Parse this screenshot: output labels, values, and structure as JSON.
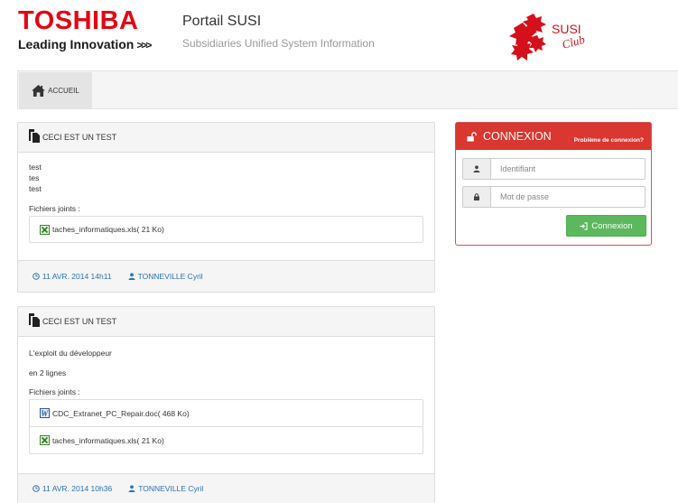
{
  "header": {
    "brand": "TOSHIBA",
    "tagline": "Leading Innovation",
    "tagline_arrows": ">>>",
    "portal_title": "Portail SUSI",
    "portal_subtitle": "Subsidiaries Unified System Information",
    "club_logo_text_1": "SUSI",
    "club_logo_text_2": "Club"
  },
  "nav": {
    "items": [
      {
        "label": "ACCUEIL",
        "icon": "home-icon"
      }
    ]
  },
  "posts": [
    {
      "title": "CECI EST UN TEST",
      "lines": [
        "test",
        "tes",
        "test"
      ],
      "files_label": "Fichiers joints :",
      "files": [
        {
          "name": "taches_informatiques.xls( 21 Ko)",
          "icon": "excel-file-icon"
        }
      ],
      "date": "11 AVR. 2014 14h11",
      "author": "TONNEVILLE Cyril"
    },
    {
      "title": "CECI EST UN TEST",
      "lines": [
        "L'exploit du développeur",
        "en 2 lignes"
      ],
      "files_label": "Fichiers joints :",
      "files": [
        {
          "name": "CDC_Extranet_PC_Repair.doc( 468 Ko)",
          "icon": "word-file-icon"
        },
        {
          "name": "taches_informatiques.xls( 21 Ko)",
          "icon": "excel-file-icon"
        }
      ],
      "date": "11 AVR. 2014 10h36",
      "author": "TONNEVILLE Cyril"
    }
  ],
  "login": {
    "title": "CONNEXION",
    "help_link": "Problème de connexion?",
    "username_placeholder": "Identifiant",
    "password_placeholder": "Mot de passe",
    "submit_label": "Connexion"
  },
  "colors": {
    "brand_red": "#e30613",
    "login_red": "#d9372f",
    "link_blue": "#2a72b8",
    "success_green": "#5cb85c"
  }
}
